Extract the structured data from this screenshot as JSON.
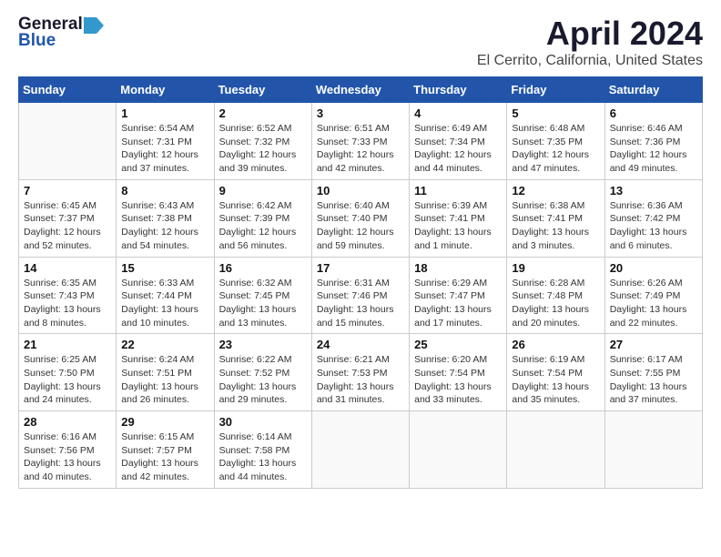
{
  "header": {
    "logo_general": "General",
    "logo_blue": "Blue",
    "month": "April 2024",
    "location": "El Cerrito, California, United States"
  },
  "weekdays": [
    "Sunday",
    "Monday",
    "Tuesday",
    "Wednesday",
    "Thursday",
    "Friday",
    "Saturday"
  ],
  "weeks": [
    [
      {
        "day": "",
        "sunrise": "",
        "sunset": "",
        "daylight": ""
      },
      {
        "day": "1",
        "sunrise": "Sunrise: 6:54 AM",
        "sunset": "Sunset: 7:31 PM",
        "daylight": "Daylight: 12 hours and 37 minutes."
      },
      {
        "day": "2",
        "sunrise": "Sunrise: 6:52 AM",
        "sunset": "Sunset: 7:32 PM",
        "daylight": "Daylight: 12 hours and 39 minutes."
      },
      {
        "day": "3",
        "sunrise": "Sunrise: 6:51 AM",
        "sunset": "Sunset: 7:33 PM",
        "daylight": "Daylight: 12 hours and 42 minutes."
      },
      {
        "day": "4",
        "sunrise": "Sunrise: 6:49 AM",
        "sunset": "Sunset: 7:34 PM",
        "daylight": "Daylight: 12 hours and 44 minutes."
      },
      {
        "day": "5",
        "sunrise": "Sunrise: 6:48 AM",
        "sunset": "Sunset: 7:35 PM",
        "daylight": "Daylight: 12 hours and 47 minutes."
      },
      {
        "day": "6",
        "sunrise": "Sunrise: 6:46 AM",
        "sunset": "Sunset: 7:36 PM",
        "daylight": "Daylight: 12 hours and 49 minutes."
      }
    ],
    [
      {
        "day": "7",
        "sunrise": "Sunrise: 6:45 AM",
        "sunset": "Sunset: 7:37 PM",
        "daylight": "Daylight: 12 hours and 52 minutes."
      },
      {
        "day": "8",
        "sunrise": "Sunrise: 6:43 AM",
        "sunset": "Sunset: 7:38 PM",
        "daylight": "Daylight: 12 hours and 54 minutes."
      },
      {
        "day": "9",
        "sunrise": "Sunrise: 6:42 AM",
        "sunset": "Sunset: 7:39 PM",
        "daylight": "Daylight: 12 hours and 56 minutes."
      },
      {
        "day": "10",
        "sunrise": "Sunrise: 6:40 AM",
        "sunset": "Sunset: 7:40 PM",
        "daylight": "Daylight: 12 hours and 59 minutes."
      },
      {
        "day": "11",
        "sunrise": "Sunrise: 6:39 AM",
        "sunset": "Sunset: 7:41 PM",
        "daylight": "Daylight: 13 hours and 1 minute."
      },
      {
        "day": "12",
        "sunrise": "Sunrise: 6:38 AM",
        "sunset": "Sunset: 7:41 PM",
        "daylight": "Daylight: 13 hours and 3 minutes."
      },
      {
        "day": "13",
        "sunrise": "Sunrise: 6:36 AM",
        "sunset": "Sunset: 7:42 PM",
        "daylight": "Daylight: 13 hours and 6 minutes."
      }
    ],
    [
      {
        "day": "14",
        "sunrise": "Sunrise: 6:35 AM",
        "sunset": "Sunset: 7:43 PM",
        "daylight": "Daylight: 13 hours and 8 minutes."
      },
      {
        "day": "15",
        "sunrise": "Sunrise: 6:33 AM",
        "sunset": "Sunset: 7:44 PM",
        "daylight": "Daylight: 13 hours and 10 minutes."
      },
      {
        "day": "16",
        "sunrise": "Sunrise: 6:32 AM",
        "sunset": "Sunset: 7:45 PM",
        "daylight": "Daylight: 13 hours and 13 minutes."
      },
      {
        "day": "17",
        "sunrise": "Sunrise: 6:31 AM",
        "sunset": "Sunset: 7:46 PM",
        "daylight": "Daylight: 13 hours and 15 minutes."
      },
      {
        "day": "18",
        "sunrise": "Sunrise: 6:29 AM",
        "sunset": "Sunset: 7:47 PM",
        "daylight": "Daylight: 13 hours and 17 minutes."
      },
      {
        "day": "19",
        "sunrise": "Sunrise: 6:28 AM",
        "sunset": "Sunset: 7:48 PM",
        "daylight": "Daylight: 13 hours and 20 minutes."
      },
      {
        "day": "20",
        "sunrise": "Sunrise: 6:26 AM",
        "sunset": "Sunset: 7:49 PM",
        "daylight": "Daylight: 13 hours and 22 minutes."
      }
    ],
    [
      {
        "day": "21",
        "sunrise": "Sunrise: 6:25 AM",
        "sunset": "Sunset: 7:50 PM",
        "daylight": "Daylight: 13 hours and 24 minutes."
      },
      {
        "day": "22",
        "sunrise": "Sunrise: 6:24 AM",
        "sunset": "Sunset: 7:51 PM",
        "daylight": "Daylight: 13 hours and 26 minutes."
      },
      {
        "day": "23",
        "sunrise": "Sunrise: 6:22 AM",
        "sunset": "Sunset: 7:52 PM",
        "daylight": "Daylight: 13 hours and 29 minutes."
      },
      {
        "day": "24",
        "sunrise": "Sunrise: 6:21 AM",
        "sunset": "Sunset: 7:53 PM",
        "daylight": "Daylight: 13 hours and 31 minutes."
      },
      {
        "day": "25",
        "sunrise": "Sunrise: 6:20 AM",
        "sunset": "Sunset: 7:54 PM",
        "daylight": "Daylight: 13 hours and 33 minutes."
      },
      {
        "day": "26",
        "sunrise": "Sunrise: 6:19 AM",
        "sunset": "Sunset: 7:54 PM",
        "daylight": "Daylight: 13 hours and 35 minutes."
      },
      {
        "day": "27",
        "sunrise": "Sunrise: 6:17 AM",
        "sunset": "Sunset: 7:55 PM",
        "daylight": "Daylight: 13 hours and 37 minutes."
      }
    ],
    [
      {
        "day": "28",
        "sunrise": "Sunrise: 6:16 AM",
        "sunset": "Sunset: 7:56 PM",
        "daylight": "Daylight: 13 hours and 40 minutes."
      },
      {
        "day": "29",
        "sunrise": "Sunrise: 6:15 AM",
        "sunset": "Sunset: 7:57 PM",
        "daylight": "Daylight: 13 hours and 42 minutes."
      },
      {
        "day": "30",
        "sunrise": "Sunrise: 6:14 AM",
        "sunset": "Sunset: 7:58 PM",
        "daylight": "Daylight: 13 hours and 44 minutes."
      },
      {
        "day": "",
        "sunrise": "",
        "sunset": "",
        "daylight": ""
      },
      {
        "day": "",
        "sunrise": "",
        "sunset": "",
        "daylight": ""
      },
      {
        "day": "",
        "sunrise": "",
        "sunset": "",
        "daylight": ""
      },
      {
        "day": "",
        "sunrise": "",
        "sunset": "",
        "daylight": ""
      }
    ]
  ]
}
